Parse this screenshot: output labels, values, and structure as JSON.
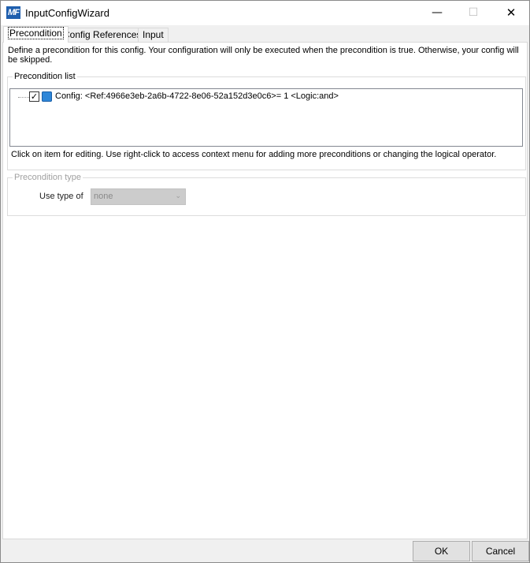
{
  "window": {
    "title": "InputConfigWizard",
    "icon_text": "MF"
  },
  "title_buttons": {
    "minimize": "—",
    "maximize": "☐",
    "close": "✕"
  },
  "tabs": [
    {
      "label": "Precondition",
      "active": true
    },
    {
      "label": "Config References",
      "active": false
    },
    {
      "label": "Input",
      "active": false
    }
  ],
  "precondition": {
    "description": "Define a precondition for this config. Your configuration will only be executed when the precondition is true. Otherwise, your config will be skipped.",
    "list_group_title": "Precondition list",
    "items": [
      {
        "checked": true,
        "check_glyph": "✓",
        "text": "Config: <Ref:4966e3eb-2a6b-4722-8e06-52a152d3e0c6>= 1 <Logic:and>"
      }
    ],
    "hint": "Click on item for editing. Use right-click to access context menu for adding more preconditions or changing the logical operator.",
    "type_group_title": "Precondition type",
    "use_type_label": "Use type of",
    "use_type_value": "none",
    "use_type_enabled": false
  },
  "buttons": {
    "ok": "OK",
    "cancel": "Cancel"
  },
  "colors": {
    "accent": "#1f5fae",
    "item_icon": "#2f87d8",
    "disabled_select": "#cccccc"
  }
}
